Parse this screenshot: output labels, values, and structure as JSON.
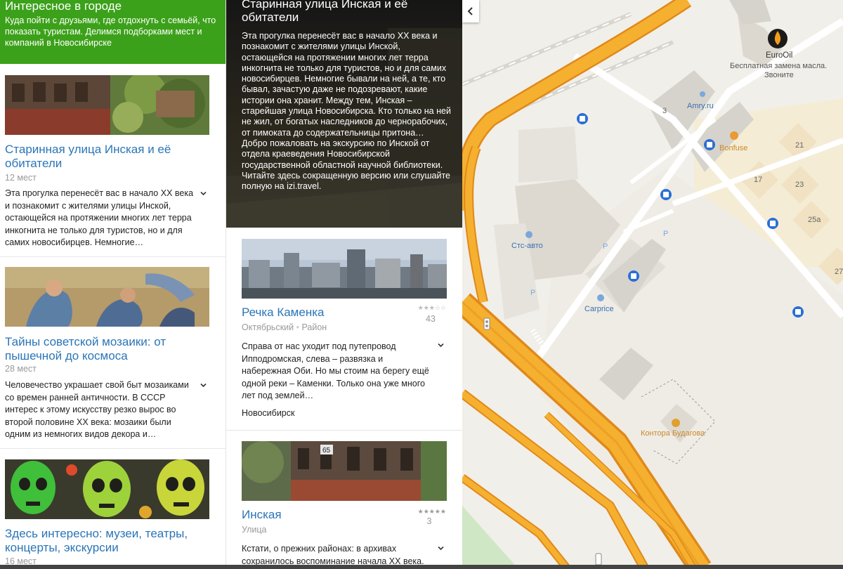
{
  "left": {
    "header": {
      "title": "Интересное в городе",
      "subtitle": "Куда пойти с друзьями, где отдохнуть с семьёй, что показать туристам. Делимся подборками мест и компаний в Новосибирске"
    },
    "collections": [
      {
        "title": "Старинная улица Инская и её обитатели",
        "count": "12 мест",
        "description": "Эта прогулка перенесёт вас в начало XX века и познакомит с жителями улицы Инской, остающейся на протяжении многих лет терра инкогнита не только для туристов, но и для самих новосибирцев. Немногие…"
      },
      {
        "title": "Тайны советской мозаики: от пышечной до космоса",
        "count": "28 мест",
        "description": "Человечество украшает свой быт мозаиками со времен ранней античности. В СССР интерес к этому искусству резко вырос во второй половине XX века: мозаики были одним из немногих видов декора и…"
      },
      {
        "title": "Здесь интересно: музеи, театры, концерты, экскурсии",
        "count": "16 мест",
        "description": ""
      }
    ]
  },
  "middle": {
    "hero": {
      "title": "Старинная улица Инская и её обитатели",
      "description": "Эта прогулка перенесёт вас в начало XX века и познакомит с жителями улицы Инской, остающейся на протяжении многих лет терра инкогнита не только для туристов, но и для самих новосибирцев. Немногие бывали на ней, а те, кто бывал, зачастую даже не подозревают, какие истории она хранит. Между тем, Инская – старейшая улица Новосибирска. Кто только на ней не жил, от богатых наследников до чернорабочих, от пимоката до содержательницы притона… Добро пожаловать на экскурсию по Инской от отдела краеведения Новосибирской государственной областной научной библиотеки. Читайте здесь сокращенную версию или слушайте полную на izi.travel."
    },
    "places": [
      {
        "title": "Речка Каменка",
        "district": "Октябрьский",
        "type": "Район",
        "stars": "★★★☆☆",
        "rating_count": "43",
        "description": "Справа от нас уходит под путепровод Ипподромская, слева – развязка и набережная Оби. Но мы стоим на берегу ещё одной реки – Каменки. Только она уже много лет под землей…",
        "city": "Новосибирск"
      },
      {
        "title": "Инская",
        "district": "Улица",
        "stars": "★★★★★",
        "rating_count": "3",
        "description": "Кстати, о прежних районах: в архивах сохранилось воспоминание начала XX века.",
        "sign": "65"
      }
    ]
  },
  "map": {
    "pois": {
      "eurooil": "EuroOil",
      "eurooil_sub1": "Бесплатная замена масла.",
      "eurooil_sub2": "Звоните",
      "amry": "Amry.ru",
      "bonfuse": "Bonfuse",
      "sts": "Стс-авто",
      "carprice": "Carprice",
      "budagov": "Контора Будагова"
    },
    "house_numbers": [
      "3",
      "21",
      "17",
      "23",
      "25а",
      "27"
    ],
    "parking": "P",
    "colors": {
      "road_major": "#f6b030",
      "road_major_dark": "#e0891a",
      "block": "#e4e1da",
      "building": "#d6d3cc",
      "poi_blue": "#2a6fd6",
      "label_orange": "#c8892b"
    }
  }
}
